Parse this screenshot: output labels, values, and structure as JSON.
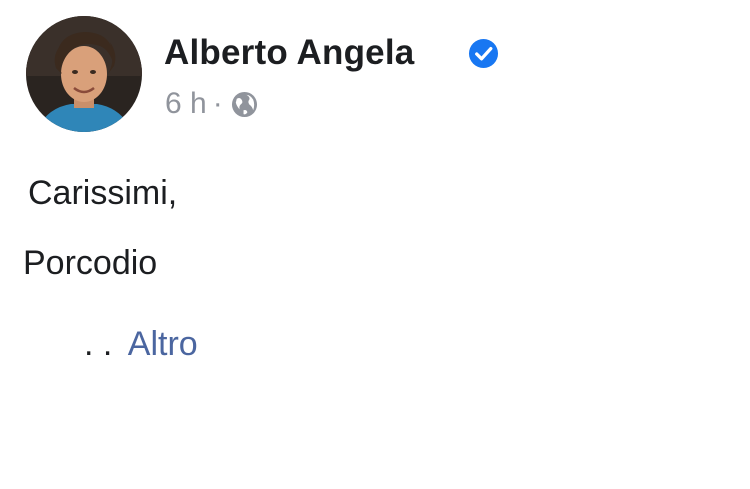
{
  "post": {
    "author": {
      "name": "Alberto Angela",
      "verified": true,
      "avatar": "avatar-photo"
    },
    "meta": {
      "time": "6 h",
      "separator": "·",
      "audience_icon": "globe-icon"
    },
    "body": {
      "lines": [
        "Carissimi,",
        "Porcodio"
      ],
      "ellipsis": ". .",
      "more_link": "Altro"
    }
  },
  "colors": {
    "name_text": "#1c1e21",
    "meta_text": "#90949c",
    "verified_badge": "#1877f2",
    "link": "#4b66a0"
  }
}
